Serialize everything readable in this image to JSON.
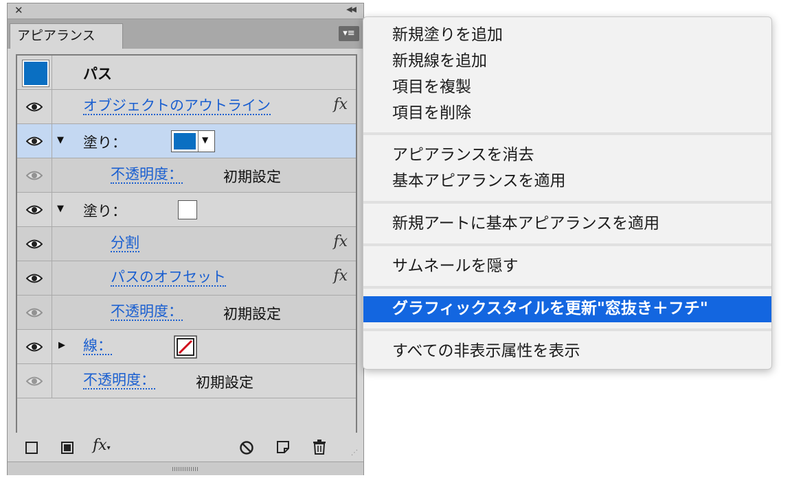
{
  "panel": {
    "tab_label": "アピアランス",
    "header_label": "パス",
    "header_swatch_color": "#0a6fc2",
    "rows": [
      {
        "label": "オブジェクトのアウトライン",
        "fx": "fx"
      },
      {
        "label": "塗り：",
        "fill_color": "#0a6fc2"
      },
      {
        "label": "不透明度：",
        "value": "初期設定"
      },
      {
        "label": "塗り：",
        "fill_color": "#ffffff"
      },
      {
        "label": "分割",
        "fx": "fx"
      },
      {
        "label": "パスのオフセット",
        "fx": "fx"
      },
      {
        "label": "不透明度：",
        "value": "初期設定"
      },
      {
        "label": "線：",
        "stroke": "none"
      },
      {
        "label": "不透明度：",
        "value": "初期設定"
      }
    ],
    "toolbar_fx": "fx"
  },
  "menu": {
    "groups": [
      [
        "新規塗りを追加",
        "新規線を追加",
        "項目を複製",
        "項目を削除"
      ],
      [
        "アピアランスを消去",
        "基本アピアランスを適用"
      ],
      [
        "新規アートに基本アピアランスを適用"
      ],
      [
        "サムネールを隠す"
      ],
      [
        "グラフィックスタイルを更新\"窓抜き＋フチ\""
      ],
      [
        "すべての非表示属性を表示"
      ]
    ],
    "highlighted": "グラフィックスタイルを更新\"窓抜き＋フチ\""
  },
  "colors": {
    "accent": "#1366e0",
    "link": "#1a5fd0",
    "selected_row": "#c4d8f2"
  }
}
